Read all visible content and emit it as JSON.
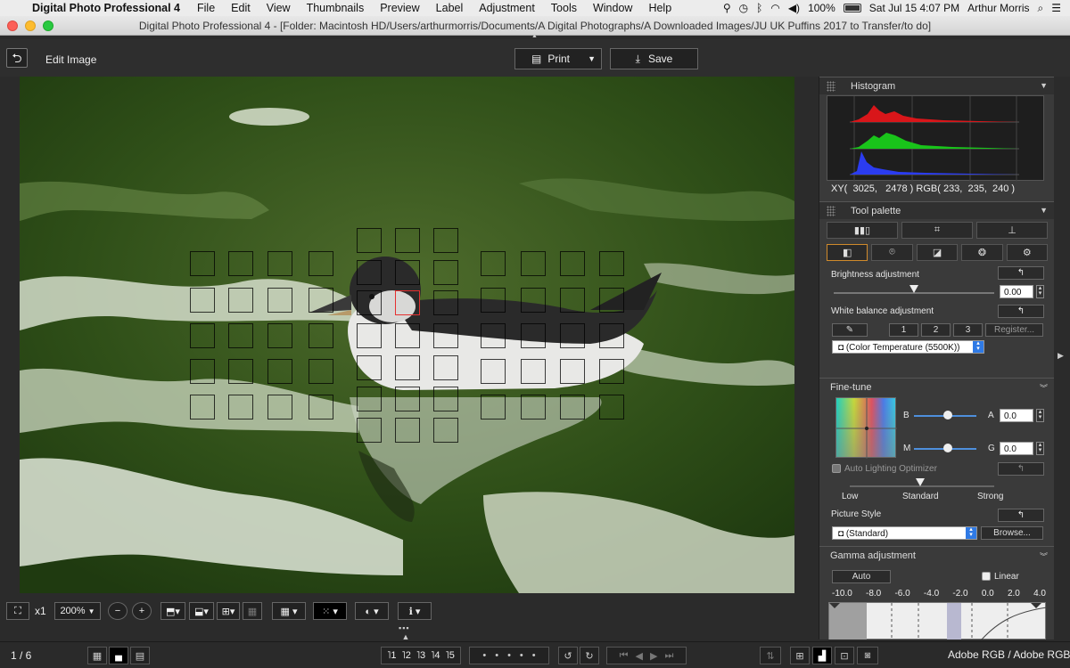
{
  "menubar": {
    "app_name": "Digital Photo Professional 4",
    "items": [
      "File",
      "Edit",
      "View",
      "Thumbnails",
      "Preview",
      "Label",
      "Adjustment",
      "Tools",
      "Window",
      "Help"
    ],
    "battery": "100%",
    "datetime": "Sat Jul 15  4:07 PM",
    "user": "Arthur Morris"
  },
  "window": {
    "title": "Digital Photo Professional 4 - [Folder: Macintosh HD/Users/arthurmorris/Documents/A Digital Photographs/A Downloaded Images/JU UK Puffins 2017 to Transfer/to do]"
  },
  "toolbar": {
    "title": "Edit Image",
    "print_label": "Print",
    "save_label": "Save"
  },
  "histogram": {
    "title": "Histogram",
    "readout": "XY(  3025,   2478 ) RGB( 233,  235,  240 )"
  },
  "tool_palette": {
    "title": "Tool palette",
    "brightness": {
      "label": "Brightness adjustment",
      "value": "0.00"
    },
    "white_balance": {
      "label": "White balance adjustment",
      "presets": [
        "1",
        "2",
        "3"
      ],
      "register": "Register...",
      "selected": "(Color Temperature (5500K))"
    }
  },
  "fine_tune": {
    "title": "Fine-tune",
    "b_label": "B",
    "a_label": "A",
    "a_value": "0.0",
    "m_label": "M",
    "g_label": "G",
    "g_value": "0.0",
    "alo_label": "Auto Lighting Optimizer",
    "levels": [
      "Low",
      "Standard",
      "Strong"
    ],
    "picture_style_label": "Picture Style",
    "picture_style_value": "(Standard)",
    "browse": "Browse..."
  },
  "gamma": {
    "title": "Gamma adjustment",
    "auto": "Auto",
    "linear": "Linear",
    "scale": [
      "-10.0",
      "-8.0",
      "-6.0",
      "-4.0",
      "-2.0",
      "0.0",
      "2.0",
      "4.0"
    ]
  },
  "viewbar": {
    "zoom_1x": "x1",
    "zoom": "200%"
  },
  "statusbar": {
    "page": "1 / 6",
    "ratings": [
      "1",
      "2",
      "3",
      "4",
      "5"
    ],
    "color_space": "Adobe RGB / Adobe RGB"
  }
}
